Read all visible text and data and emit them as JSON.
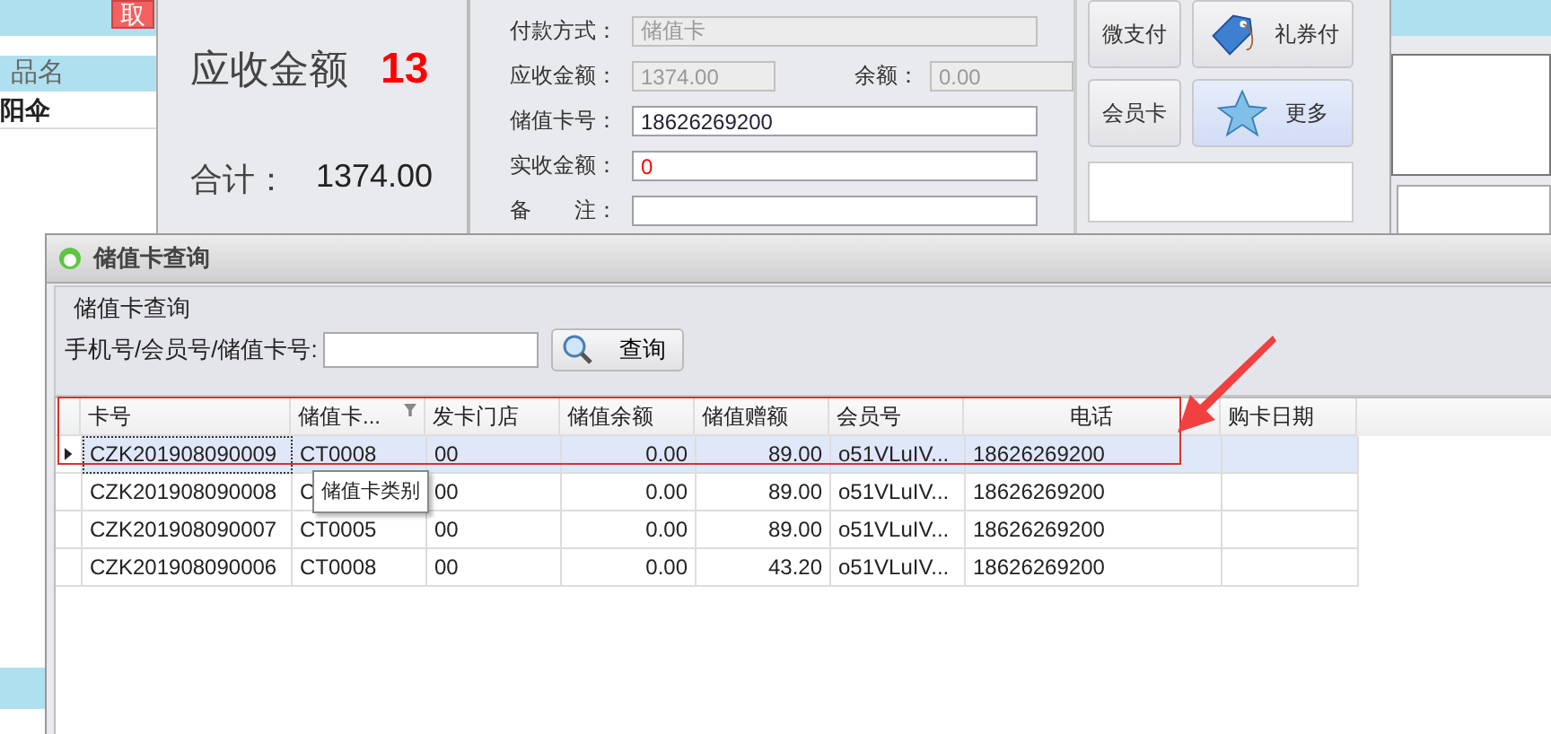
{
  "background": {
    "left_panel": {
      "button": "取",
      "column_header": "品名",
      "row": "阳伞"
    },
    "amount_panel": {
      "due_label": "应收金额",
      "due_value": "13",
      "total_label": "合计：",
      "total_value": "1374.00"
    },
    "payment_form": {
      "rows": [
        [
          {
            "label": "付款方式：",
            "value": "储值卡",
            "disabled": true,
            "alert": false
          }
        ],
        [
          {
            "label": "应收金额：",
            "value": "1374.00",
            "disabled": true,
            "alert": false
          },
          {
            "label": "余额：",
            "value": "0.00",
            "disabled": true,
            "alert": false
          }
        ],
        [
          {
            "label": "储值卡号：",
            "value": "18626269200",
            "disabled": false,
            "alert": false
          }
        ],
        [
          {
            "label": "实收金额：",
            "value": "0",
            "disabled": false,
            "alert": true
          }
        ],
        [
          {
            "label": "备　　注：",
            "disabled": false
          }
        ]
      ]
    },
    "payment_buttons": [
      {
        "label": "微支付",
        "kind": "plain",
        "selected": false
      },
      {
        "label": "礼券付",
        "kind": "tag",
        "selected": false
      },
      {
        "label": "会员卡",
        "kind": "plain",
        "selected": false
      },
      {
        "label": "更多",
        "kind": "star",
        "selected": true
      }
    ]
  },
  "dialog": {
    "title": "储值卡查询",
    "group_title": "储值卡查询",
    "search": {
      "label": "手机号/会员号/储值卡号:",
      "button": "查询"
    },
    "table": {
      "columns": [
        {
          "label": "卡号",
          "filter": false
        },
        {
          "label": "储值卡...",
          "filter": true
        },
        {
          "label": "发卡门店",
          "filter": false
        },
        {
          "label": "储值余额",
          "filter": false
        },
        {
          "label": "储值赠额",
          "filter": false
        },
        {
          "label": "会员号",
          "filter": false
        },
        {
          "label": "电话",
          "filter": false
        },
        {
          "label": "购卡日期",
          "filter": false
        }
      ],
      "rows": [
        {
          "selected": true,
          "cells": [
            "CZK201908090009",
            "CT0008",
            "00",
            "0.00",
            "89.00",
            "o51VLuIV...",
            "18626269200"
          ]
        },
        {
          "selected": false,
          "cells": [
            "CZK201908090008",
            "C",
            "00",
            "0.00",
            "89.00",
            "o51VLuIV...",
            "18626269200"
          ]
        },
        {
          "selected": false,
          "cells": [
            "CZK201908090007",
            "CT0005",
            "00",
            "0.00",
            "89.00",
            "o51VLuIV...",
            "18626269200"
          ]
        },
        {
          "selected": false,
          "cells": [
            "CZK201908090006",
            "CT0008",
            "00",
            "0.00",
            "43.20",
            "o51VLuIV...",
            "18626269200"
          ]
        }
      ]
    },
    "tooltip": "储值卡类别"
  }
}
